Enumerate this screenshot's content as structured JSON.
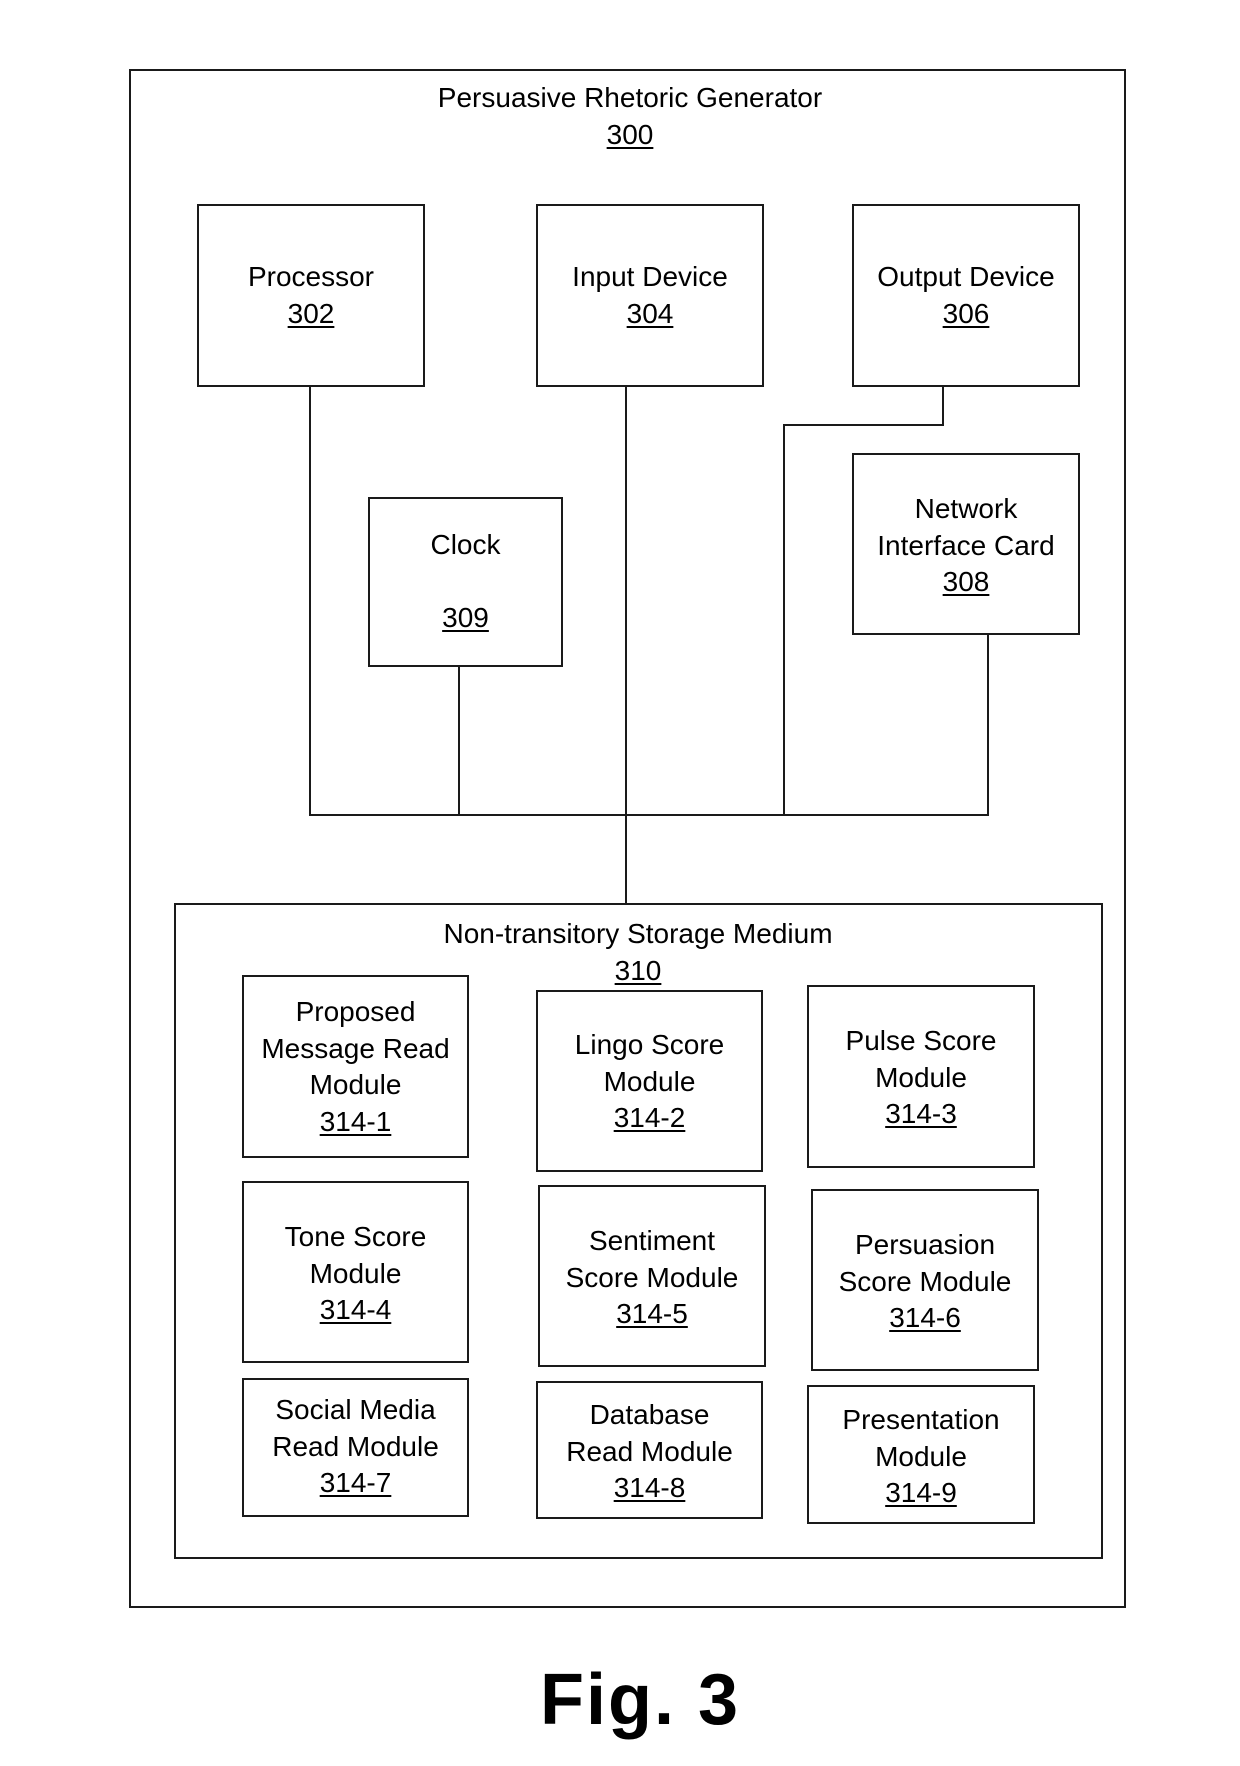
{
  "diagram": {
    "title": "Persuasive Rhetoric Generator",
    "ref": "300",
    "components": {
      "processor": {
        "label": [
          "Processor"
        ],
        "ref": "302"
      },
      "input_device": {
        "label": [
          "Input Device"
        ],
        "ref": "304"
      },
      "output_device": {
        "label": [
          "Output Device"
        ],
        "ref": "306"
      },
      "clock": {
        "label": [
          "Clock"
        ],
        "ref": "309"
      },
      "network_interface_card": {
        "label": [
          "Network",
          "Interface Card"
        ],
        "ref": "308"
      }
    },
    "storage": {
      "title": "Non-transitory Storage Medium",
      "ref": "310",
      "modules": [
        {
          "label": [
            "Proposed",
            "Message Read",
            "Module"
          ],
          "ref": "314-1"
        },
        {
          "label": [
            "Lingo Score",
            "Module"
          ],
          "ref": "314-2"
        },
        {
          "label": [
            "Pulse Score",
            "Module"
          ],
          "ref": "314-3"
        },
        {
          "label": [
            "Tone Score",
            "Module"
          ],
          "ref": "314-4"
        },
        {
          "label": [
            "Sentiment",
            "Score Module"
          ],
          "ref": "314-5"
        },
        {
          "label": [
            "Persuasion",
            "Score Module"
          ],
          "ref": "314-6"
        },
        {
          "label": [
            "Social Media",
            "Read Module"
          ],
          "ref": "314-7"
        },
        {
          "label": [
            "Database",
            "Read Module"
          ],
          "ref": "314-8"
        },
        {
          "label": [
            "Presentation",
            "Module"
          ],
          "ref": "314-9"
        }
      ]
    },
    "connections": [
      [
        "processor",
        "bus"
      ],
      [
        "clock",
        "bus"
      ],
      [
        "input_device",
        "bus"
      ],
      [
        "output_device",
        "bus"
      ],
      [
        "network_interface_card",
        "bus"
      ],
      [
        "bus",
        "storage"
      ]
    ],
    "figure_label": "Fig. 3"
  }
}
